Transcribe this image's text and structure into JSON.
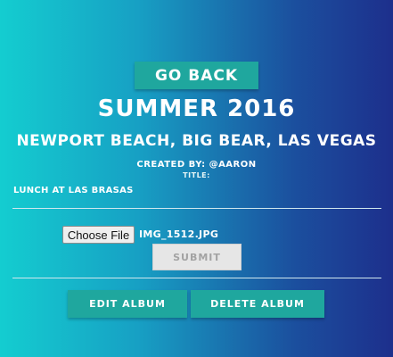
{
  "nav": {
    "go_back_label": "Go Back"
  },
  "album": {
    "title": "Summer 2016",
    "locations": "Newport Beach, Big Bear, Las Vegas",
    "created_by": "Created By: @aaron",
    "title_label": "Title:"
  },
  "photo": {
    "caption": "Lunch at Las Brasas"
  },
  "upload": {
    "choose_file_label": "Choose File",
    "file_name": "IMG_1512.jpg",
    "submit_label": "Submit"
  },
  "actions": {
    "edit_label": "Edit Album",
    "delete_label": "Delete Album"
  },
  "colors": {
    "accent_button": "#1fa79e",
    "gradient_start": "#14cdd0",
    "gradient_end": "#1d2f8c"
  }
}
